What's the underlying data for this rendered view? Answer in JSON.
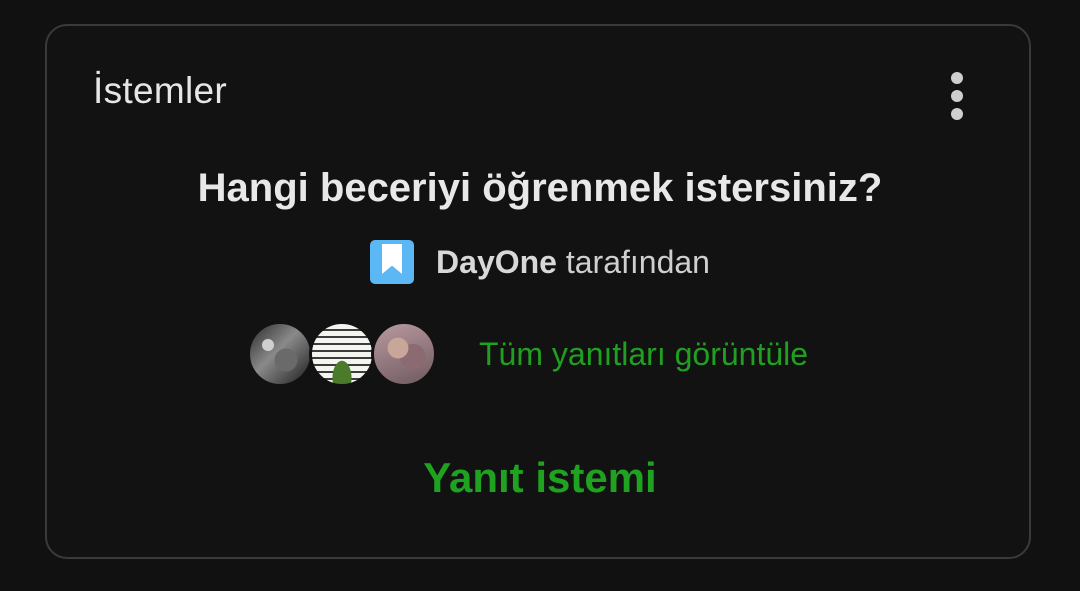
{
  "card": {
    "title": "İstemler",
    "menu_icon": "more-vertical-icon"
  },
  "prompt": {
    "question": "Hangi beceriyi öğrenmek istersiniz?",
    "author": {
      "app_icon": "bookmark-icon",
      "app_name": "DayOne",
      "suffix": " tarafından"
    }
  },
  "responses": {
    "view_all_label": "Tüm yanıtları görüntüle"
  },
  "actions": {
    "respond_label": "Yanıt istemi"
  },
  "colors": {
    "accent_green": "#1fa21f",
    "app_icon_blue": "#5bb8f5",
    "background": "#121212",
    "border": "#3a3a3a"
  }
}
